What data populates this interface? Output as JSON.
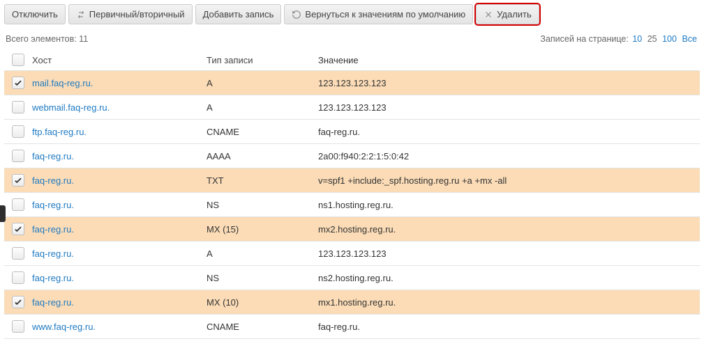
{
  "toolbar": {
    "disable": "Отключить",
    "primary_secondary": "Первичный/вторичный",
    "add": "Добавить запись",
    "reset": "Вернуться к значениям по умолчанию",
    "delete": "Удалить"
  },
  "meta": {
    "total_label": "Всего элементов: 11",
    "per_page_label": "Записей на странице:",
    "per_page_options": [
      "10",
      "25",
      "100",
      "Все"
    ],
    "per_page_current": "25"
  },
  "columns": {
    "host": "Хост",
    "type": "Тип записи",
    "value": "Значение"
  },
  "rows": [
    {
      "checked": true,
      "host": "mail.faq-reg.ru.",
      "type": "A",
      "value": "123.123.123.123"
    },
    {
      "checked": false,
      "host": "webmail.faq-reg.ru.",
      "type": "A",
      "value": "123.123.123.123"
    },
    {
      "checked": false,
      "host": "ftp.faq-reg.ru.",
      "type": "CNAME",
      "value": "faq-reg.ru."
    },
    {
      "checked": false,
      "host": "faq-reg.ru.",
      "type": "AAAA",
      "value": "2a00:f940:2:2:1:5:0:42"
    },
    {
      "checked": true,
      "host": "faq-reg.ru.",
      "type": "TXT",
      "value": "v=spf1 +include:_spf.hosting.reg.ru +a +mx -all"
    },
    {
      "checked": false,
      "host": "faq-reg.ru.",
      "type": "NS",
      "value": "ns1.hosting.reg.ru."
    },
    {
      "checked": true,
      "host": "faq-reg.ru.",
      "type": "MX (15)",
      "value": "mx2.hosting.reg.ru."
    },
    {
      "checked": false,
      "host": "faq-reg.ru.",
      "type": "A",
      "value": "123.123.123.123"
    },
    {
      "checked": false,
      "host": "faq-reg.ru.",
      "type": "NS",
      "value": "ns2.hosting.reg.ru."
    },
    {
      "checked": true,
      "host": "faq-reg.ru.",
      "type": "MX (10)",
      "value": "mx1.hosting.reg.ru."
    },
    {
      "checked": false,
      "host": "www.faq-reg.ru.",
      "type": "CNAME",
      "value": "faq-reg.ru."
    }
  ]
}
